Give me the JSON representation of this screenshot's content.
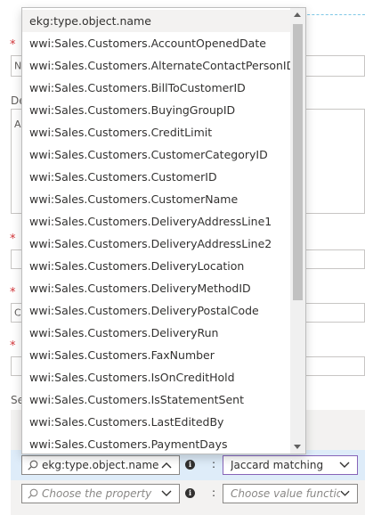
{
  "dropdown": {
    "items": [
      "ekg:type.object.name",
      "wwi:Sales.Customers.AccountOpenedDate",
      "wwi:Sales.Customers.AlternateContactPersonID",
      "wwi:Sales.Customers.BillToCustomerID",
      "wwi:Sales.Customers.BuyingGroupID",
      "wwi:Sales.Customers.CreditLimit",
      "wwi:Sales.Customers.CustomerCategoryID",
      "wwi:Sales.Customers.CustomerID",
      "wwi:Sales.Customers.CustomerName",
      "wwi:Sales.Customers.DeliveryAddressLine1",
      "wwi:Sales.Customers.DeliveryAddressLine2",
      "wwi:Sales.Customers.DeliveryLocation",
      "wwi:Sales.Customers.DeliveryMethodID",
      "wwi:Sales.Customers.DeliveryPostalCode",
      "wwi:Sales.Customers.DeliveryRun",
      "wwi:Sales.Customers.FaxNumber",
      "wwi:Sales.Customers.IsOnCreditHold",
      "wwi:Sales.Customers.IsStatementSent",
      "wwi:Sales.Customers.LastEditedBy",
      "wwi:Sales.Customers.PaymentDays"
    ],
    "selected_index": 0
  },
  "form": {
    "required_marker": "*",
    "partial_label_de": "De",
    "partial_label_se": "Se",
    "peek_n": "N",
    "peek_a": "A",
    "peek_c": "C"
  },
  "rows": [
    {
      "property_value": "ekg:type.object.name",
      "colon": ":",
      "function_value": "Jaccard matching"
    },
    {
      "property_placeholder": "Choose the property",
      "colon": ":",
      "function_placeholder": "Choose value function"
    }
  ],
  "info_glyph": "i",
  "colors": {
    "required": "#d13438",
    "highlight_row": "#deecf9",
    "focus_border": "#8764b8"
  }
}
